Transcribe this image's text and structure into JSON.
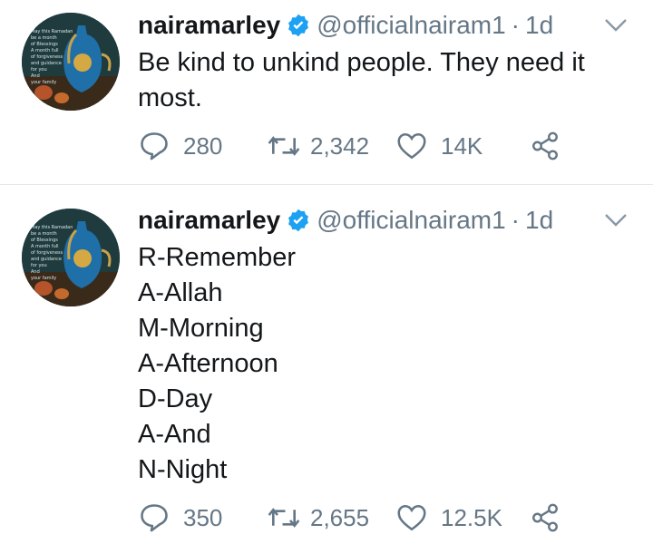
{
  "tweets": [
    {
      "name": "nairamarley",
      "handle": "@officialnairam1",
      "separator": "·",
      "time": "1d",
      "text_lines": [
        "Be kind to unkind people. They need it",
        "most."
      ],
      "replies": "280",
      "retweets": "2,342",
      "likes": "14K"
    },
    {
      "name": "nairamarley",
      "handle": "@officialnairam1",
      "separator": "·",
      "time": "1d",
      "text_lines": [
        "R-Remember",
        "A-Allah",
        "M-Morning",
        "A-Afternoon",
        "D-Day",
        "A-And",
        "N-Night"
      ],
      "replies": "350",
      "retweets": "2,655",
      "likes": "12.5K"
    }
  ],
  "avatar_text": [
    "May this Ramadan",
    "be a month",
    "of Blessings",
    "A month full",
    "of forgiveness",
    "and guidance",
    "for you",
    "And",
    "your family"
  ],
  "colors": {
    "verified": "#1da1f2",
    "icon_gray": "#657786",
    "divider": "#e1e8ed"
  }
}
